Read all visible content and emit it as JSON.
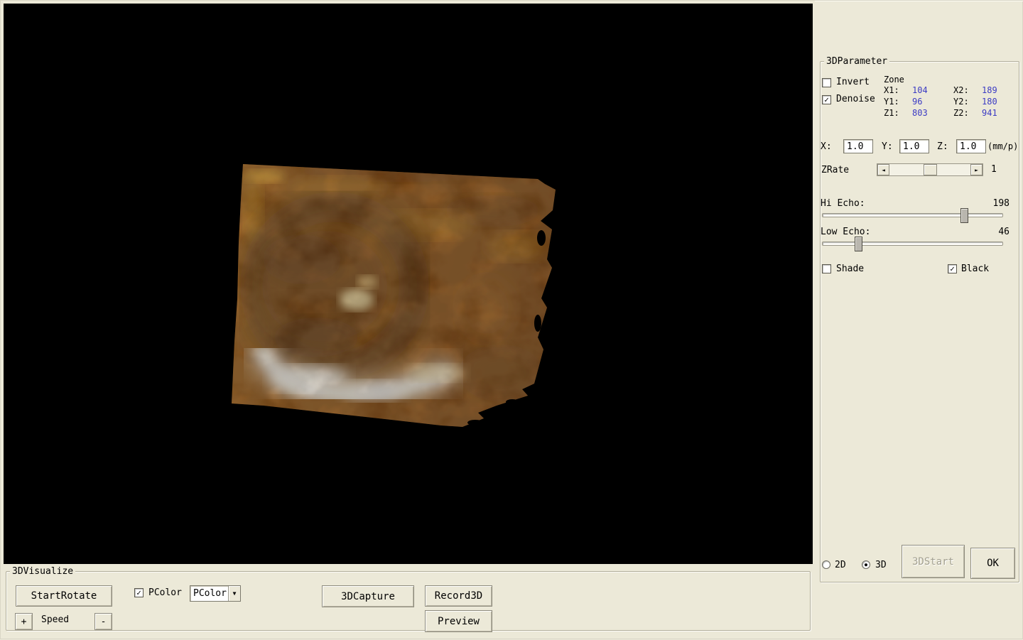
{
  "colors": {
    "window_bg": "#ece9d8",
    "viewport_bg": "#000000",
    "value_text": "#3b3bc4"
  },
  "icons": {
    "check": "✓",
    "radio_dot": "●",
    "dropdown_arrow": "▼",
    "scroll_left_arrow": "◄",
    "scroll_right_arrow": "►"
  },
  "parameter_panel": {
    "title": "3DParameter",
    "invert": {
      "label": "Invert",
      "checked": false,
      "glyph": ""
    },
    "denoise": {
      "label": "Denoise",
      "checked": true,
      "glyph": "✓"
    },
    "zone": {
      "title": "Zone",
      "x1_label": "X1:",
      "x1": "104",
      "x2_label": "X2:",
      "x2": "189",
      "y1_label": "Y1:",
      "y1": "96",
      "y2_label": "Y2:",
      "y2": "180",
      "z1_label": "Z1:",
      "z1": "803",
      "z2_label": "Z2:",
      "z2": "941"
    },
    "scale": {
      "x_label": "X:",
      "x_value": "1.0",
      "y_label": "Y:",
      "y_value": "1.0",
      "z_label": "Z:",
      "z_value": "1.0",
      "unit": "(mm/p)"
    },
    "zrate": {
      "label": "ZRate",
      "value": "1",
      "thumb_percent": 50
    },
    "hi_echo": {
      "label": "Hi Echo:",
      "value": "198",
      "percent": 79
    },
    "low_echo": {
      "label": "Low Echo:",
      "value": "46",
      "percent": 20
    },
    "shade": {
      "label": "Shade",
      "checked": false,
      "glyph": ""
    },
    "black": {
      "label": "Black",
      "checked": true,
      "glyph": "✓"
    },
    "mode_2d": {
      "label": "2D",
      "selected": false,
      "glyph": ""
    },
    "mode_3d": {
      "label": "3D",
      "selected": true,
      "glyph": "●"
    },
    "start_3d_button": {
      "label": "3DStart",
      "enabled": false
    },
    "ok_button": {
      "label": "OK"
    }
  },
  "visualize_panel": {
    "title": "3DVisualize",
    "start_rotate_button": "StartRotate",
    "speed_plus_button": "+",
    "speed_label": "Speed",
    "speed_minus_button": "-",
    "pcolor_checkbox": {
      "label": "PColor",
      "checked": true,
      "glyph": "✓"
    },
    "pcolor_dropdown": {
      "value": "PColor"
    },
    "capture_button": "3DCapture",
    "record_button": "Record3D",
    "preview_button": "Preview"
  }
}
